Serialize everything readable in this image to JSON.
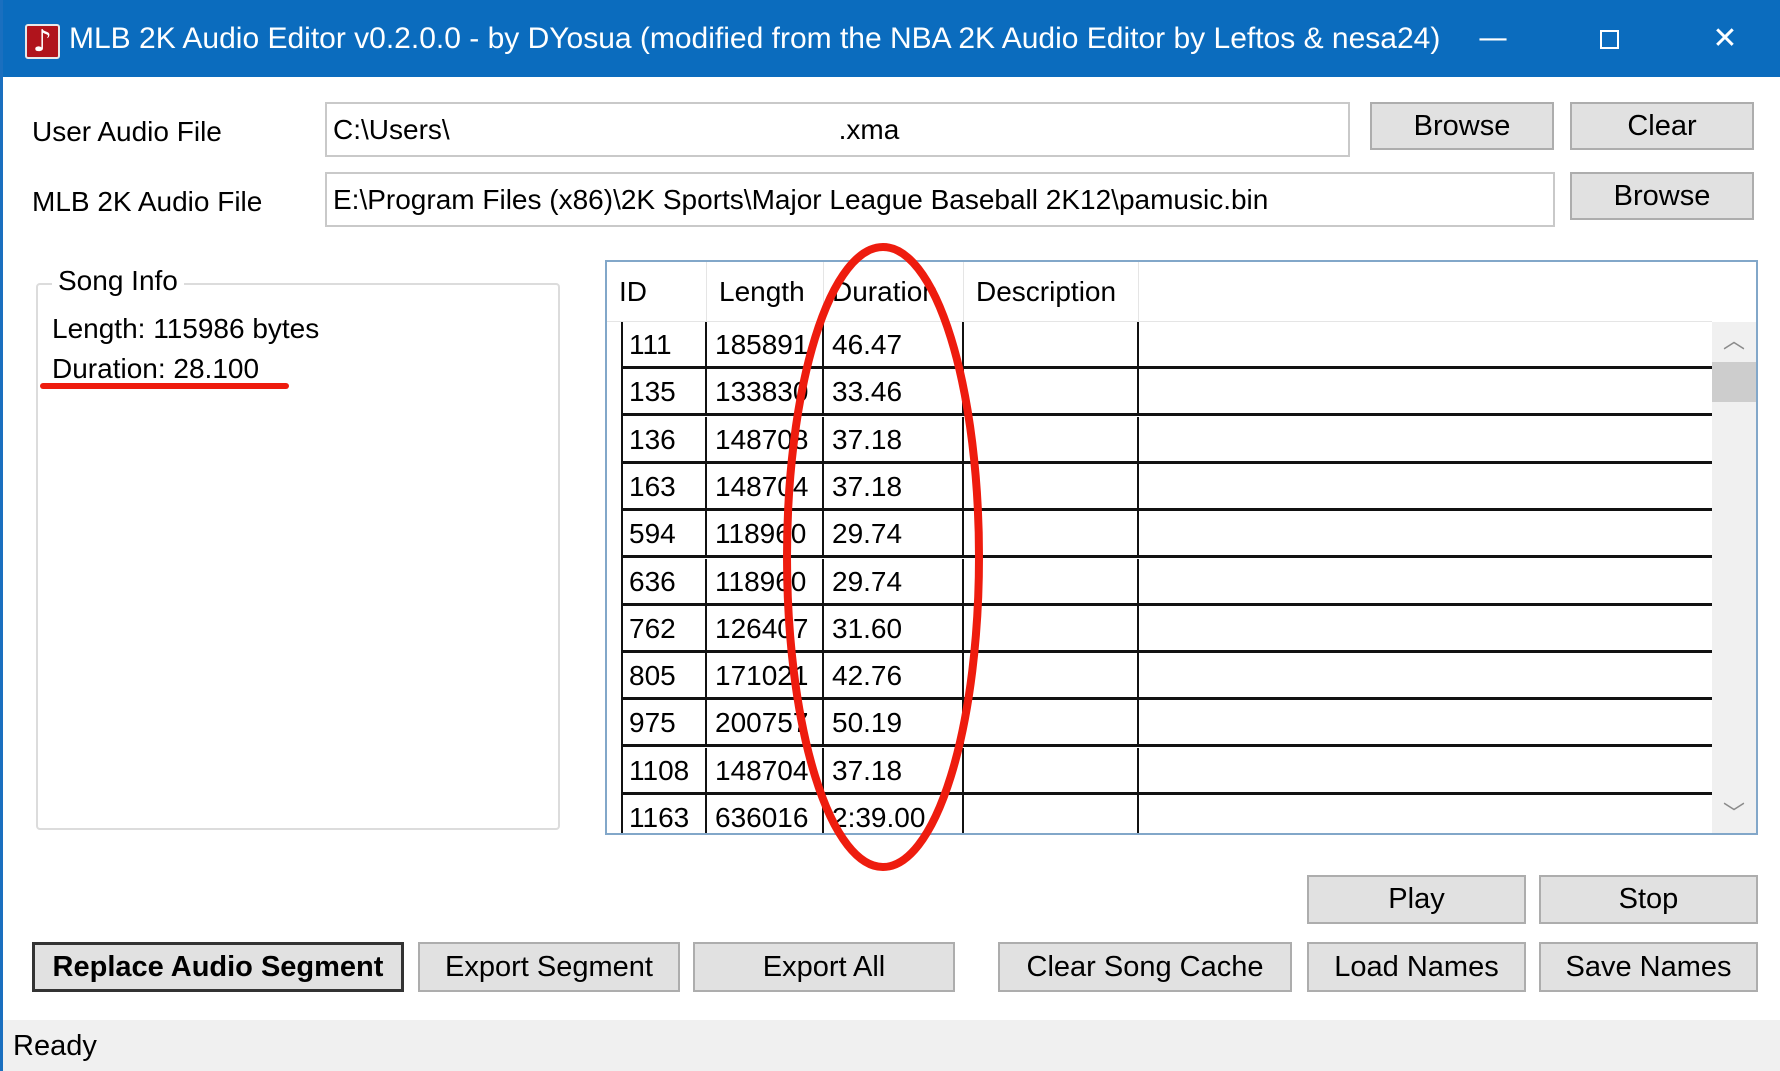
{
  "window": {
    "title": "MLB 2K Audio Editor v0.2.0.0 - by DYosua (modified from the NBA 2K Audio Editor by Leftos & nesa24)",
    "icon": "music-note-icon",
    "controls": {
      "minimize": "—",
      "close": "✕"
    }
  },
  "files": {
    "user_label": "User Audio File",
    "user_value": "C:\\Users\\                                                  .xma",
    "mlb_label": "MLB 2K Audio File",
    "mlb_value": "E:\\Program Files (x86)\\2K Sports\\Major League Baseball 2K12\\pamusic.bin",
    "browse_label": "Browse",
    "clear_label": "Clear"
  },
  "song_info": {
    "title": "Song Info",
    "length": "Length: 115986 bytes",
    "duration": "Duration: 28.100"
  },
  "table": {
    "columns": [
      "ID",
      "Length",
      "Duration",
      "Description"
    ],
    "rows": [
      {
        "id": "111",
        "length": "185891",
        "duration": "46.47",
        "description": ""
      },
      {
        "id": "135",
        "length": "133830",
        "duration": "33.46",
        "description": ""
      },
      {
        "id": "136",
        "length": "148708",
        "duration": "37.18",
        "description": ""
      },
      {
        "id": "163",
        "length": "148704",
        "duration": "37.18",
        "description": ""
      },
      {
        "id": "594",
        "length": "118960",
        "duration": "29.74",
        "description": ""
      },
      {
        "id": "636",
        "length": "118960",
        "duration": "29.74",
        "description": ""
      },
      {
        "id": "762",
        "length": "126407",
        "duration": "31.60",
        "description": ""
      },
      {
        "id": "805",
        "length": "171021",
        "duration": "42.76",
        "description": ""
      },
      {
        "id": "975",
        "length": "200757",
        "duration": "50.19",
        "description": ""
      },
      {
        "id": "1108",
        "length": "148704",
        "duration": "37.18",
        "description": ""
      },
      {
        "id": "1163",
        "length": "636016",
        "duration": "2:39.00",
        "description": ""
      }
    ]
  },
  "buttons": {
    "play": "Play",
    "stop": "Stop",
    "replace": "Replace Audio Segment",
    "export_segment": "Export Segment",
    "export_all": "Export All",
    "clear_cache": "Clear Song Cache",
    "load_names": "Load Names",
    "save_names": "Save Names"
  },
  "status": {
    "text": "Ready"
  },
  "colors": {
    "titlebar": "#0b6cbe",
    "annotation": "#ee1c0e",
    "button_face": "#e1e1e1"
  }
}
